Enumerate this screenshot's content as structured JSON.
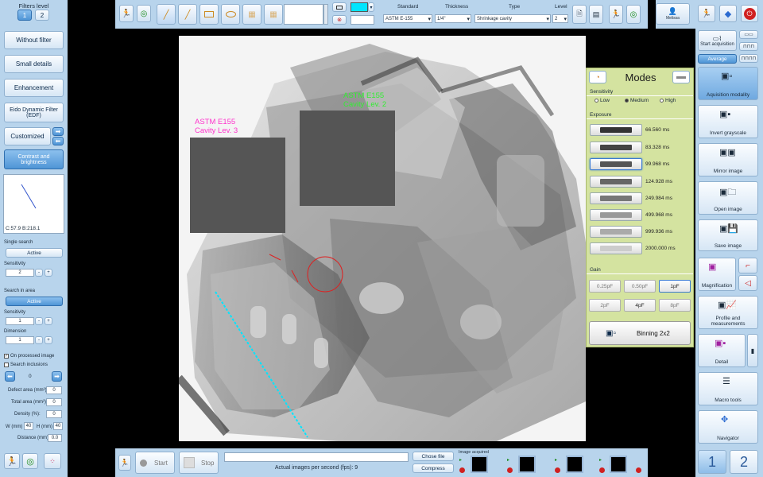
{
  "left": {
    "filters_level_label": "Filters level",
    "level_buttons": [
      "1",
      "2"
    ],
    "without_filter": "Without filter",
    "small_details": "Small details",
    "enhancement": "Enhancement",
    "edf": "Eido Dynamic Filter (EDF)",
    "customized": "Customized",
    "contrast": "Contrast and brightness",
    "curve_readout": "C:57.9  B:218.1",
    "single_search": "Single search",
    "active_1": "Active",
    "sensitivity_label_1": "Sensitivity",
    "sensitivity_value_1": "2",
    "search_in_area": "Search in area",
    "active_2": "Active",
    "sensitivity_label_2": "Sensitivity",
    "sensitivity_value_2": "1",
    "dimension_label": "Dimension",
    "dimension_value": "1",
    "on_processed_image": "On processed image",
    "search_inclusions": "Search inclusions",
    "nav_value": "0",
    "defect_area_label": "Defect area (mm²):",
    "defect_area_value": "0",
    "total_area_label": "Total area (mm²):",
    "total_area_value": "0",
    "density_label": "Density (%):",
    "density_value": "0",
    "w_label": "W (mm)",
    "w_value": "40",
    "h_label": "H (mm)",
    "h_value": "40",
    "distance_label": "Distance (mm)",
    "distance_value": "0.0"
  },
  "top": {
    "standard_label": "Standard",
    "standard_value": "ASTM E-155",
    "thickness_label": "Thickness",
    "thickness_value": "1/4\"",
    "type_label": "Type",
    "type_value": "Shrinkage cavity",
    "level_label": "Level",
    "level_value": "2",
    "user_name": "Melissa",
    "accent_color": "#00e5ff"
  },
  "viewer": {
    "ref1_line1": "ASTM E155",
    "ref1_line2": "Cavity Lev. 3",
    "ref2_line1": "ASTM E155",
    "ref2_line2": "Cavity Lev. 2",
    "ref1_color": "#ff33cc",
    "ref2_color": "#33ee33"
  },
  "modes": {
    "title": "Modes",
    "sensitivity_label": "Sensitivity",
    "sens_options": [
      "Low",
      "Medium",
      "High"
    ],
    "sens_selected": "Medium",
    "exposure_label": "Exposure",
    "exposures": [
      "66.560 ms",
      "83.328 ms",
      "99.968 ms",
      "124.928 ms",
      "249.984 ms",
      "499.968 ms",
      "999.936 ms",
      "2000.000 ms"
    ],
    "exposure_selected_index": 2,
    "gain_label": "Gain",
    "gains": [
      "0.25pF",
      "0.50pF",
      "1pF",
      "2pF",
      "4pF",
      "8pF"
    ],
    "gain_selected": "1pF",
    "binning": "Binning 2x2"
  },
  "right": {
    "start_acquisition": "Start acquisition",
    "average": "Average",
    "acquisition_modality": "Aquisition modality",
    "invert_grayscale": "Invert grayscale",
    "mirror_image": "Mirror image",
    "open_image": "Open image",
    "save_image": "Save image",
    "magnification": "Magnification",
    "profile": "Profile and measurements",
    "detail": "Detail",
    "macro_tools": "Macro tools",
    "navigator": "Navigator",
    "page_buttons": [
      "1",
      "2"
    ]
  },
  "bottom": {
    "start": "Start",
    "stop": "Stop",
    "choose_file": "Chose file",
    "compress": "Compress",
    "fps_text": "Actual images per second (fps): 9",
    "image_acquired": "Image acquired"
  }
}
